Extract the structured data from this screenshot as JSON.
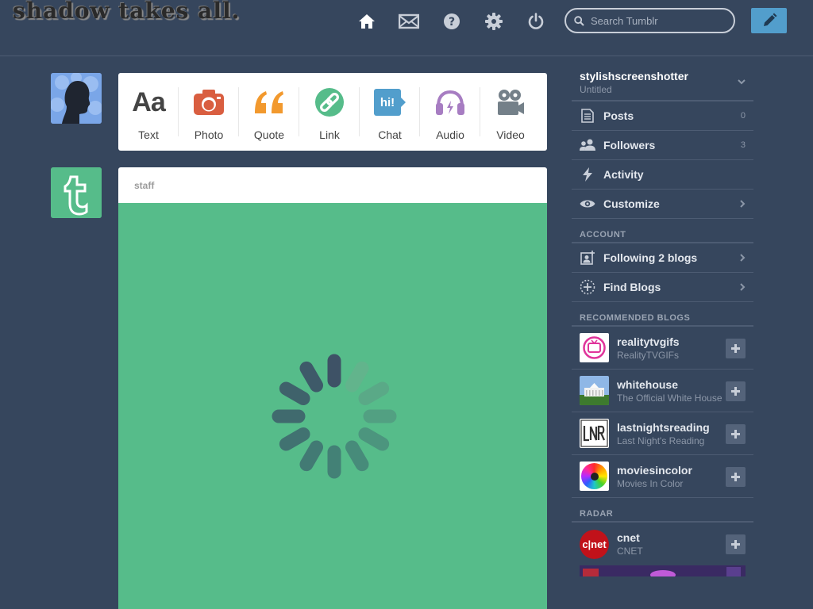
{
  "header": {
    "logo_text": "shadow takes all.",
    "search": {
      "placeholder": "Search Tumblr"
    },
    "icons": [
      "home-icon",
      "mail-icon",
      "help-icon",
      "gear-icon",
      "power-icon",
      "pencil-icon"
    ]
  },
  "post_types": [
    {
      "label": "Text",
      "icon": "text-icon",
      "color": "#444444",
      "glyph": "Aa"
    },
    {
      "label": "Photo",
      "icon": "camera-icon",
      "color": "#d95e40"
    },
    {
      "label": "Quote",
      "icon": "quote-icon",
      "color": "#f2992e"
    },
    {
      "label": "Link",
      "icon": "link-icon",
      "color": "#56bc8a"
    },
    {
      "label": "Chat",
      "icon": "chat-icon",
      "color": "#529ecc",
      "glyph": "hi!"
    },
    {
      "label": "Audio",
      "icon": "headphones-icon",
      "color": "#a77dc2"
    },
    {
      "label": "Video",
      "icon": "video-camera-icon",
      "color": "#748089"
    }
  ],
  "post": {
    "author": "staff",
    "media_color": "#56bc8a"
  },
  "sidebar": {
    "blog_name": "stylishscreenshotter",
    "blog_subtitle": "Untitled",
    "menu": [
      {
        "label": "Posts",
        "count": "0",
        "icon": "posts-icon"
      },
      {
        "label": "Followers",
        "count": "3",
        "icon": "followers-icon"
      },
      {
        "label": "Activity",
        "icon": "lightning-icon"
      },
      {
        "label": "Customize",
        "icon": "eye-icon"
      }
    ],
    "account_title": "ACCOUNT",
    "account": [
      {
        "label": "Following 2 blogs",
        "icon": "following-icon"
      },
      {
        "label": "Find Blogs",
        "icon": "find-blogs-icon"
      }
    ],
    "recommended_title": "RECOMMENDED BLOGS",
    "recommended": [
      {
        "name": "realitytvgifs",
        "desc": "RealityTVGIFs"
      },
      {
        "name": "whitehouse",
        "desc": "The Official White House"
      },
      {
        "name": "lastnightsreading",
        "desc": "Last Night's Reading"
      },
      {
        "name": "moviesincolor",
        "desc": "Movies In Color"
      }
    ],
    "radar_title": "RADAR",
    "radar": [
      {
        "name": "cnet",
        "desc": "CNET"
      }
    ]
  },
  "colors": {
    "background": "#36465d",
    "accent": "#529ecc",
    "divider": "#4d5c73"
  }
}
